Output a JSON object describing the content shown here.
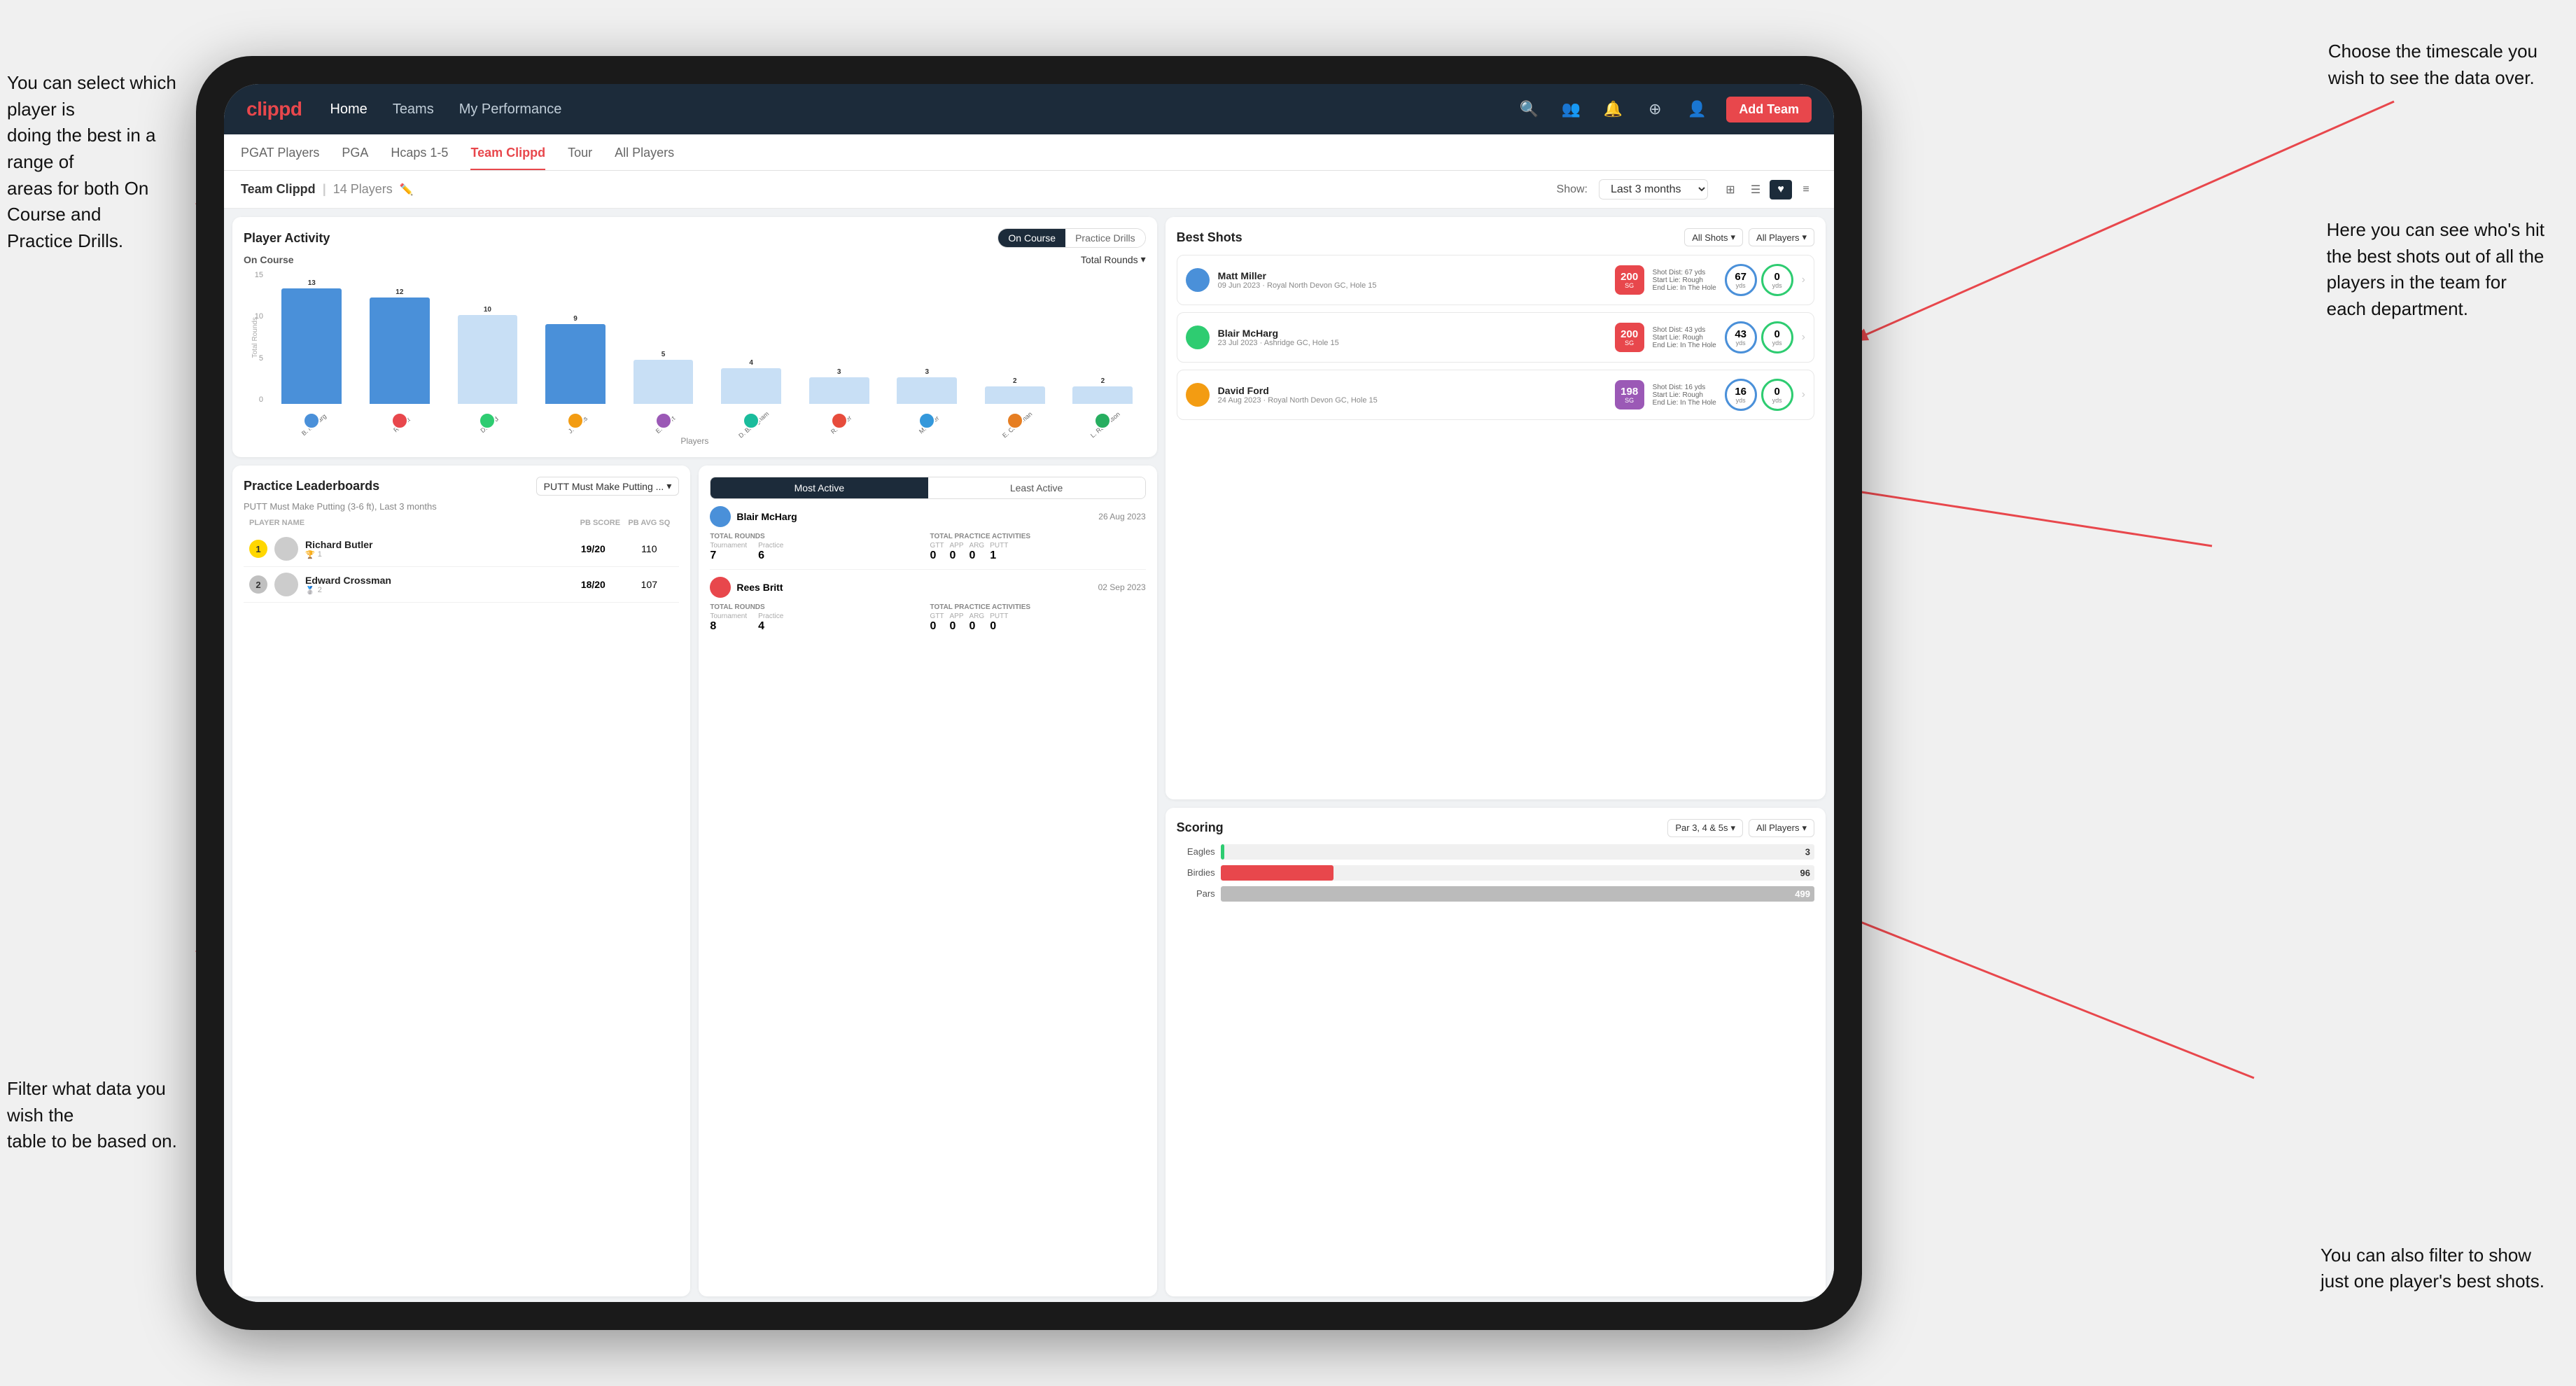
{
  "annotations": {
    "ann1": "You can select which player is\ndoing the best in a range of\nareas for both On Course and\nPractice Drills.",
    "ann2": "Choose the timescale you\nwish to see the data over.",
    "ann3": "Filter what data you wish the\ntable to be based on.",
    "ann4": "You can also filter to show\njust one player's best shots.",
    "ann5": "Here you can see who's hit\nthe best shots out of all the\nplayers in the team for\neach department."
  },
  "nav": {
    "logo": "clippd",
    "links": [
      "Home",
      "Teams",
      "My Performance"
    ],
    "add_team_label": "Add Team"
  },
  "sub_tabs": [
    "PGAT Players",
    "PGA",
    "Hcaps 1-5",
    "Team Clippd",
    "Tour",
    "All Players"
  ],
  "active_sub_tab": "Team Clippd",
  "team_header": {
    "name": "Team Clippd",
    "player_count": "14 Players",
    "show_label": "Show:",
    "time_value": "Last 3 months"
  },
  "player_activity": {
    "title": "Player Activity",
    "toggle_on_course": "On Course",
    "toggle_practice": "Practice Drills",
    "chart_label": "On Course",
    "dropdown_label": "Total Rounds",
    "y_labels": [
      "15",
      "10",
      "5",
      "0"
    ],
    "y_axis_title": "Total Rounds",
    "bars": [
      {
        "name": "B. McHarg",
        "value": 13,
        "pct": 87
      },
      {
        "name": "R. Britt",
        "value": 12,
        "pct": 80
      },
      {
        "name": "D. Ford",
        "value": 10,
        "pct": 67
      },
      {
        "name": "J. Coles",
        "value": 9,
        "pct": 60
      },
      {
        "name": "E. Ebert",
        "value": 5,
        "pct": 33
      },
      {
        "name": "D. Billingham",
        "value": 4,
        "pct": 27
      },
      {
        "name": "R. Butler",
        "value": 3,
        "pct": 20
      },
      {
        "name": "M. Miller",
        "value": 3,
        "pct": 20
      },
      {
        "name": "E. Crossman",
        "value": 2,
        "pct": 13
      },
      {
        "name": "L. Robertson",
        "value": 2,
        "pct": 13
      }
    ],
    "x_axis_title": "Players"
  },
  "best_shots": {
    "title": "Best Shots",
    "filter1": "All Shots",
    "filter2": "All Players",
    "players": [
      {
        "name": "Matt Miller",
        "course": "09 Jun 2023 · Royal North Devon GC, Hole 15",
        "badge": "200",
        "badge_sub": "SG",
        "dist": "Shot Dist: 67 yds\nStart Lie: Rough\nEnd Lie: In The Hole",
        "stat1": "67",
        "stat1_unit": "yds",
        "stat2": "0",
        "stat2_unit": "yds"
      },
      {
        "name": "Blair McHarg",
        "course": "23 Jul 2023 · Ashridge GC, Hole 15",
        "badge": "200",
        "badge_sub": "SG",
        "dist": "Shot Dist: 43 yds\nStart Lie: Rough\nEnd Lie: In The Hole",
        "stat1": "43",
        "stat1_unit": "yds",
        "stat2": "0",
        "stat2_unit": "yds"
      },
      {
        "name": "David Ford",
        "course": "24 Aug 2023 · Royal North Devon GC, Hole 15",
        "badge": "198",
        "badge_sub": "SG",
        "dist": "Shot Dist: 16 yds\nStart Lie: Rough\nEnd Lie: In The Hole",
        "stat1": "16",
        "stat1_unit": "yds",
        "stat2": "0",
        "stat2_unit": "yds"
      }
    ]
  },
  "practice_leaderboards": {
    "title": "Practice Leaderboards",
    "dropdown": "PUTT Must Make Putting ...",
    "subtitle": "PUTT Must Make Putting (3-6 ft), Last 3 months",
    "cols": [
      "PLAYER NAME",
      "PB SCORE",
      "PB AVG SQ"
    ],
    "rows": [
      {
        "rank": 1,
        "name": "Richard Butler",
        "score": "19/20",
        "avg": "110"
      },
      {
        "rank": 2,
        "name": "Edward Crossman",
        "score": "18/20",
        "avg": "107"
      }
    ]
  },
  "most_active": {
    "tab_most": "Most Active",
    "tab_least": "Least Active",
    "players": [
      {
        "name": "Blair McHarg",
        "date": "26 Aug 2023",
        "total_rounds_label": "Total Rounds",
        "tournament": 7,
        "practice": 6,
        "total_practice_label": "Total Practice Activities",
        "gtt": 0,
        "app": 0,
        "arg": 0,
        "putt": 1
      },
      {
        "name": "Rees Britt",
        "date": "02 Sep 2023",
        "total_rounds_label": "Total Rounds",
        "tournament": 8,
        "practice": 4,
        "total_practice_label": "Total Practice Activities",
        "gtt": 0,
        "app": 0,
        "arg": 0,
        "putt": 0
      }
    ]
  },
  "scoring": {
    "title": "Scoring",
    "filter1": "Par 3, 4 & 5s",
    "filter2": "All Players",
    "bars": [
      {
        "label": "Eagles",
        "value": 3,
        "max": 499,
        "color": "#2ecc71"
      },
      {
        "label": "Birdies",
        "value": 96,
        "max": 499,
        "color": "#e8474c"
      },
      {
        "label": "Pars",
        "value": 499,
        "max": 499,
        "color": "#aaa"
      }
    ]
  },
  "colors": {
    "accent": "#e8474c",
    "nav_bg": "#1c2b3a",
    "brand_blue": "#4a90d9"
  }
}
